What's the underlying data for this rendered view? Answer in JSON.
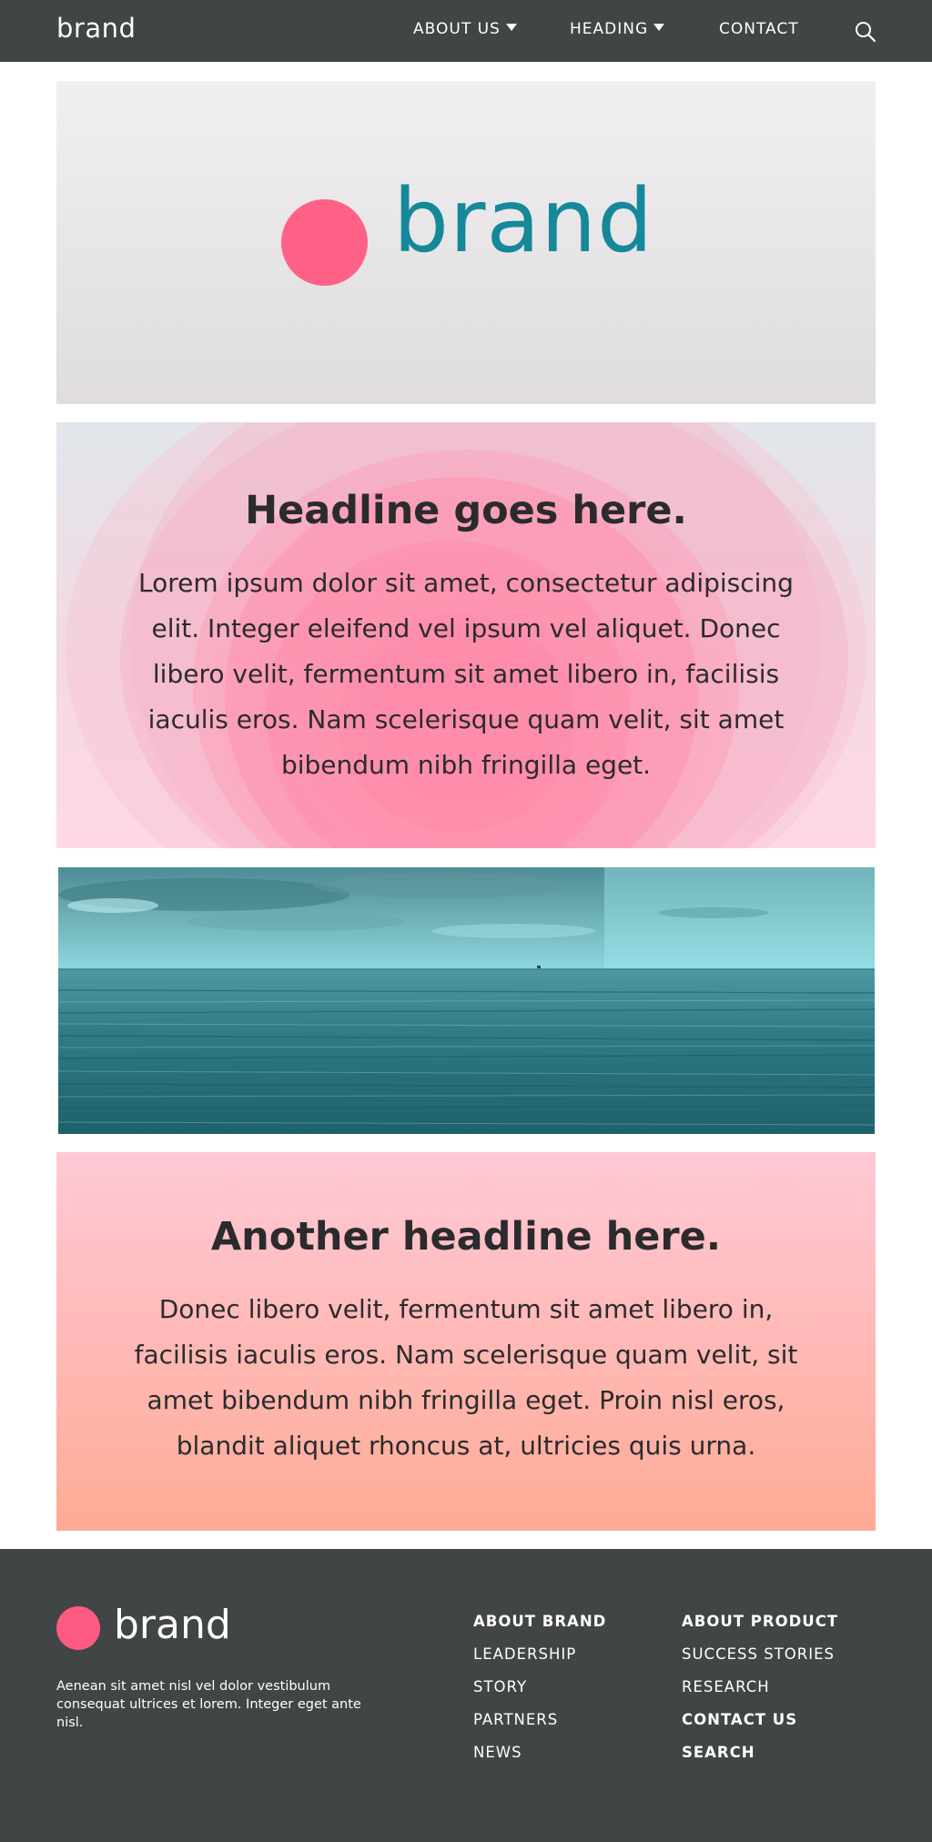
{
  "topnav": {
    "brand": "brand",
    "items": [
      {
        "label": "ABOUT US",
        "has_dropdown": true
      },
      {
        "label": "HEADING",
        "has_dropdown": true
      },
      {
        "label": "CONTACT",
        "has_dropdown": false
      }
    ],
    "search_icon": "search-icon"
  },
  "hero": {
    "brand": "brand",
    "dot_color": "#ff6286",
    "word_color": "#158899"
  },
  "card1": {
    "headline": "Headline goes here.",
    "body": "Lorem ipsum dolor sit amet, consectetur adipiscing elit. Integer eleifend vel ipsum vel aliquet. Donec libero velit, fermentum sit amet libero in, facilisis iaculis eros. Nam scelerisque quam velit, sit amet bibendum nibh fringilla eget."
  },
  "card2": {
    "headline": "Another headline here.",
    "body": "Donec libero velit, fermentum sit amet libero in, facilisis iaculis eros. Nam scelerisque quam velit, sit amet bibendum nibh fringilla eget. Proin nisl eros, blandit aliquet rhoncus at, ultricies quis urna."
  },
  "footer": {
    "brand": "brand",
    "description": "Aenean sit amet nisl vel dolor vestibulum consequat ultrices et lorem. Integer eget ante nisl.",
    "col1": [
      "ABOUT BRAND",
      "LEADERSHIP",
      "STORY",
      "PARTNERS",
      "NEWS"
    ],
    "col2": [
      "ABOUT PRODUCT",
      "SUCCESS STORIES",
      "RESEARCH",
      "CONTACT US",
      "SEARCH"
    ]
  },
  "colors": {
    "nav_bg": "#424545",
    "accent_pink": "#ff6286",
    "brand_teal": "#158899"
  }
}
